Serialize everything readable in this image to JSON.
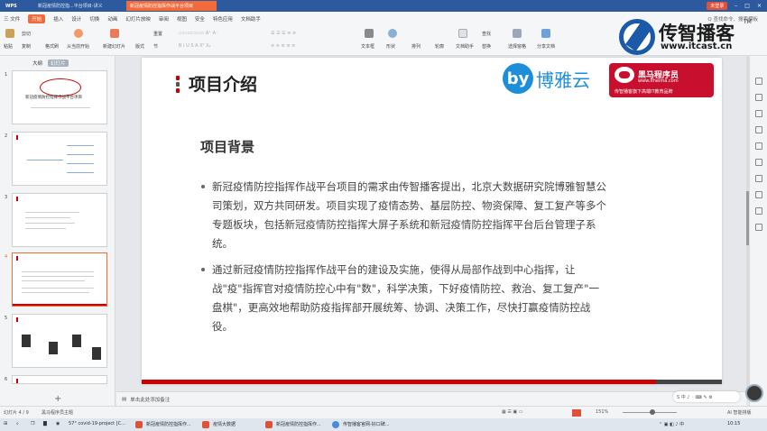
{
  "titlebar": {
    "app": "WPS",
    "tabs": [
      "新冠疫情防控指...平台项目-讲义",
      "新冠疫情防控指挥作战平台项目"
    ],
    "account": "未登录"
  },
  "menu": {
    "file": "三 文件",
    "items": [
      "开始",
      "插入",
      "设计",
      "切换",
      "动画",
      "幻灯片放映",
      "审阅",
      "视图",
      "安全",
      "特色应用",
      "文档助手"
    ],
    "search": "Q 查找命令、搜索模板"
  },
  "ribbon": {
    "paste": "粘贴",
    "cut": "剪切",
    "copy": "复制",
    "format_painter": "格式刷",
    "from_current": "从当前开始",
    "new_slide": "新建幻灯片",
    "layout": "版式",
    "section": "节",
    "reset": "重置",
    "textbox": "文本框",
    "shape": "形状",
    "arrange": "排列",
    "outline": "轮廓",
    "doc_assistant": "文档助手",
    "find": "查找",
    "replace": "替换",
    "select_pane": "选择窗格",
    "share": "分享文档"
  },
  "brand": {
    "cn": "传智播客",
    "url": "www.itcast.cn",
    "tm": "TM"
  },
  "left_panel": {
    "tab_outline": "大纲",
    "tab_slides": "幻灯片",
    "thumbs": [
      "1",
      "2",
      "3",
      "4",
      "5",
      "6"
    ],
    "thumb1_title": "新冠疫情防控指挥作战平台项目",
    "add": "+"
  },
  "slide": {
    "title": "项目介绍",
    "bmy_logo": "by",
    "bmy_name": "博雅云",
    "heima_name": "黑马程序员",
    "heima_url": "www.itheima.com",
    "heima_slogan": "传智播客旗下高端IT教育品牌",
    "subtitle": "项目背景",
    "para1": "新冠疫情防控指挥作战平台项目的需求由传智播客提出，北京大数据研究院博雅智慧公司策划，双方共同研发。项目实现了疫情态势、基层防控、物资保障、复工复产等多个专题板块，包括新冠疫情防控指挥大屏子系统和新冠疫情防控指挥平台后台管理子系统。",
    "para2": "通过新冠疫情防控指挥作战平台的建设及实施，使得从局部作战到中心指挥，让战\"疫\"指挥官对疫情防控心中有\"数\"，科学决策，下好疫情防控、救治、复工复产\"一盘棋\"，更高效地帮助防疫指挥部开展统筹、协调、决策工作，尽快打赢疫情防控战役。"
  },
  "notes": {
    "placeholder": "单击此处添加备注"
  },
  "status": {
    "slide": "幻灯片 4 / 9",
    "theme": "黑马程序员主题",
    "zoom": "151%",
    "ai": "AI 智能排版"
  },
  "taskbar": {
    "items": [
      "57° covid-19-project [C...",
      "新冠疫情防控指挥作...",
      "疫情大数据",
      "新冠疫情防控指挥作...",
      "传智播客官网-好口碑..."
    ],
    "time": "10:15"
  }
}
